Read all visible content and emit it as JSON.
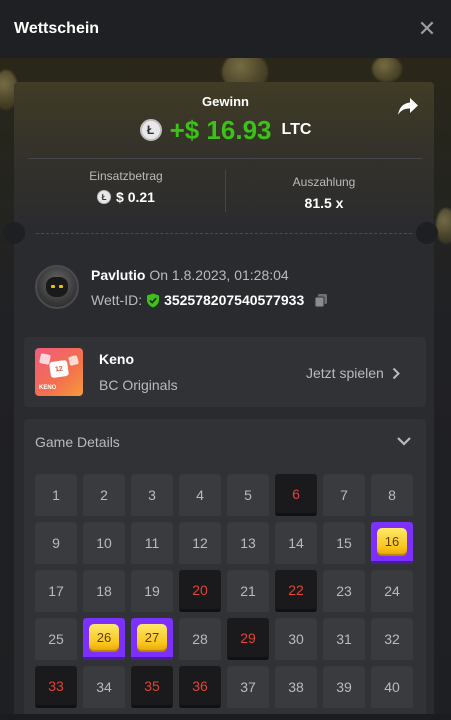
{
  "header": {
    "title": "Wettschein"
  },
  "win": {
    "label": "Gewinn",
    "currency_icon": "ltc-icon",
    "amount": "+$ 16.93",
    "currency": "LTC"
  },
  "stats": {
    "bet_label": "Einsatzbetrag",
    "bet_value": "$ 0.21",
    "payout_label": "Auszahlung",
    "payout_value": "81.5 x"
  },
  "user": {
    "name": "Pavlutio",
    "on_text": "On 1.8.2023, 01:28:04",
    "bet_id_label": "Wett-ID:",
    "bet_id": "352578207540577933"
  },
  "game": {
    "thumb_number": "12",
    "thumb_label": "KENO",
    "name": "Keno",
    "provider": "BC Originals",
    "play_label": "Jetzt spielen"
  },
  "details": {
    "title": "Game Details",
    "numbers": [
      {
        "n": "1",
        "state": "normal"
      },
      {
        "n": "2",
        "state": "normal"
      },
      {
        "n": "3",
        "state": "normal"
      },
      {
        "n": "4",
        "state": "normal"
      },
      {
        "n": "5",
        "state": "normal"
      },
      {
        "n": "6",
        "state": "picked"
      },
      {
        "n": "7",
        "state": "normal"
      },
      {
        "n": "8",
        "state": "normal"
      },
      {
        "n": "9",
        "state": "normal"
      },
      {
        "n": "10",
        "state": "normal"
      },
      {
        "n": "11",
        "state": "normal"
      },
      {
        "n": "12",
        "state": "normal"
      },
      {
        "n": "13",
        "state": "normal"
      },
      {
        "n": "14",
        "state": "normal"
      },
      {
        "n": "15",
        "state": "normal"
      },
      {
        "n": "16",
        "state": "hit"
      },
      {
        "n": "17",
        "state": "normal"
      },
      {
        "n": "18",
        "state": "normal"
      },
      {
        "n": "19",
        "state": "normal"
      },
      {
        "n": "20",
        "state": "picked"
      },
      {
        "n": "21",
        "state": "normal"
      },
      {
        "n": "22",
        "state": "picked"
      },
      {
        "n": "23",
        "state": "normal"
      },
      {
        "n": "24",
        "state": "normal"
      },
      {
        "n": "25",
        "state": "normal"
      },
      {
        "n": "26",
        "state": "hit"
      },
      {
        "n": "27",
        "state": "hit"
      },
      {
        "n": "28",
        "state": "normal"
      },
      {
        "n": "29",
        "state": "picked"
      },
      {
        "n": "30",
        "state": "normal"
      },
      {
        "n": "31",
        "state": "normal"
      },
      {
        "n": "32",
        "state": "normal"
      },
      {
        "n": "33",
        "state": "picked"
      },
      {
        "n": "34",
        "state": "normal"
      },
      {
        "n": "35",
        "state": "picked"
      },
      {
        "n": "36",
        "state": "picked"
      },
      {
        "n": "37",
        "state": "normal"
      },
      {
        "n": "38",
        "state": "normal"
      },
      {
        "n": "39",
        "state": "normal"
      },
      {
        "n": "40",
        "state": "normal"
      }
    ]
  },
  "colors": {
    "win_green": "#3bc117",
    "hit_purple": "#7c30ff",
    "picked_red": "#e0423c",
    "gem_yellow": "#f8c51b"
  }
}
